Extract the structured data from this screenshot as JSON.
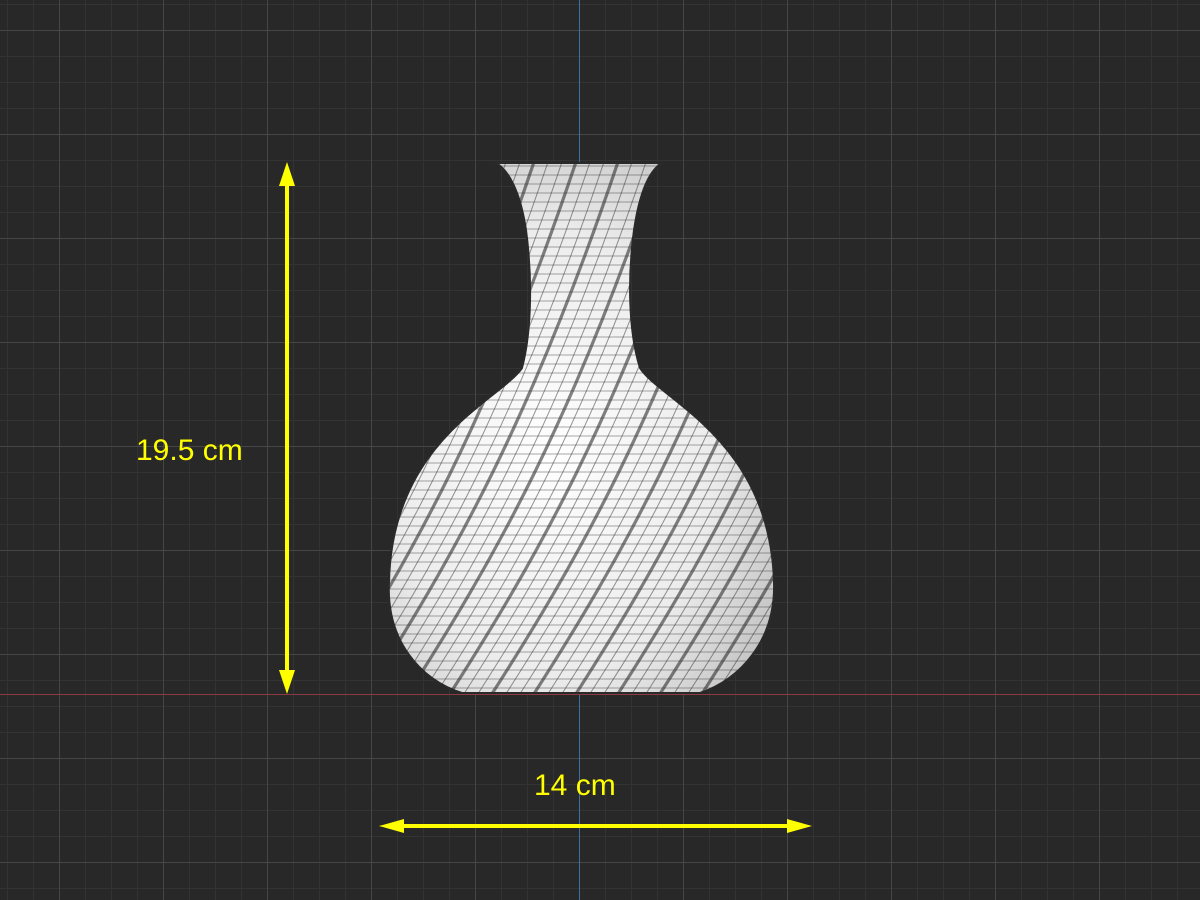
{
  "viewport": {
    "background_color": "#282828",
    "grid_major_color": "#484848",
    "grid_minor_color": "#343434",
    "axis_y_color": "#3f6f9f",
    "axis_x_color": "#8a3a40",
    "grid_visible": true
  },
  "model": {
    "object": "vase-mesh",
    "surface_color": "#f2f2f2",
    "wire_color": "#2e2e2e"
  },
  "dimensions": {
    "color": "#ffff00",
    "height_label": "19.5 cm",
    "width_label": "14 cm"
  }
}
